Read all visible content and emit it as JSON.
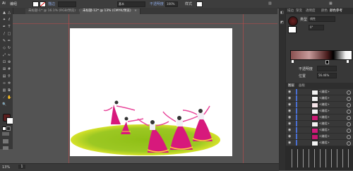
{
  "control_bar": {
    "object_type": "编组",
    "stroke_label": "描边",
    "stroke_value": "",
    "brush_value": "基本",
    "opacity_label": "不透明度",
    "opacity_value": "100%",
    "style_label": "样式"
  },
  "document_tabs": [
    {
      "label": "未标题-1* @ 16.1% (RGB/预览)",
      "active": false
    },
    {
      "label": "未标题-12* @ 13% (CMYK/预览)",
      "active": true
    }
  ],
  "tools": [
    {
      "icon": "selection-arrow-icon",
      "glyph": "▲"
    },
    {
      "icon": "direct-selection-icon",
      "glyph": "△"
    },
    {
      "icon": "magic-wand-icon",
      "glyph": "✦"
    },
    {
      "icon": "lasso-icon",
      "glyph": "ℓ"
    },
    {
      "icon": "pen-icon",
      "glyph": "✒"
    },
    {
      "icon": "type-icon",
      "glyph": "T"
    },
    {
      "icon": "line-icon",
      "glyph": "/"
    },
    {
      "icon": "rectangle-icon",
      "glyph": "□"
    },
    {
      "icon": "paintbrush-icon",
      "glyph": "✎"
    },
    {
      "icon": "pencil-icon",
      "glyph": "✏"
    },
    {
      "icon": "eraser-icon",
      "glyph": "◇"
    },
    {
      "icon": "rotate-icon",
      "glyph": "↻"
    },
    {
      "icon": "scale-icon",
      "glyph": "⤢"
    },
    {
      "icon": "warp-icon",
      "glyph": "≈"
    },
    {
      "icon": "free-transform-icon",
      "glyph": "⊡"
    },
    {
      "icon": "shape-builder-icon",
      "glyph": "⊕"
    },
    {
      "icon": "perspective-icon",
      "glyph": "⊞"
    },
    {
      "icon": "mesh-icon",
      "glyph": "#"
    },
    {
      "icon": "gradient-icon",
      "glyph": "▤"
    },
    {
      "icon": "eyedropper-icon",
      "glyph": "⚲"
    },
    {
      "icon": "blend-icon",
      "glyph": "∞"
    },
    {
      "icon": "symbol-sprayer-icon",
      "glyph": "✲"
    },
    {
      "icon": "graph-icon",
      "glyph": "▥"
    },
    {
      "icon": "artboard-icon",
      "glyph": "⧉"
    },
    {
      "icon": "slice-icon",
      "glyph": "⟋"
    },
    {
      "icon": "hand-icon",
      "glyph": "✋"
    },
    {
      "icon": "zoom-icon",
      "glyph": "🔍"
    }
  ],
  "status": {
    "zoom": "13%",
    "page": "1"
  },
  "gradient_panel": {
    "tabs": [
      "描边",
      "渐变",
      "透明度",
      "颜色",
      "颜色参考"
    ],
    "type_label": "类型",
    "type_value": "线性",
    "angle_value": "0°",
    "opacity_label": "不透明度",
    "location_label": "位置",
    "location_value": "56.46%"
  },
  "layers_panel": {
    "tabs": [
      "图层",
      "画板"
    ],
    "rows": [
      {
        "name": "<编组>",
        "thumb_color": "#f2f2f2"
      },
      {
        "name": "<编组>",
        "thumb_color": "#f2f2f2"
      },
      {
        "name": "<编组>",
        "thumb_color": "#f4e3e7"
      },
      {
        "name": "<编组>",
        "thumb_color": "#f2f2f2"
      },
      {
        "name": "<编组>",
        "thumb_color": "#cc1a74"
      },
      {
        "name": "<编组>",
        "thumb_color": "#f0f0f0"
      },
      {
        "name": "<编组>",
        "thumb_color": "#d11b7c"
      },
      {
        "name": "<编组>",
        "thumb_color": "#c51870"
      },
      {
        "name": "<编组>",
        "thumb_color": "#f2f2f2"
      }
    ]
  },
  "colors": {
    "ground": "#9bc424",
    "ground_edge": "#c8dc1c",
    "skirt": "#d7197c",
    "skirt_band": "#ffd23b",
    "ribbon": "#e8479b",
    "guide": "#c24a4a"
  }
}
